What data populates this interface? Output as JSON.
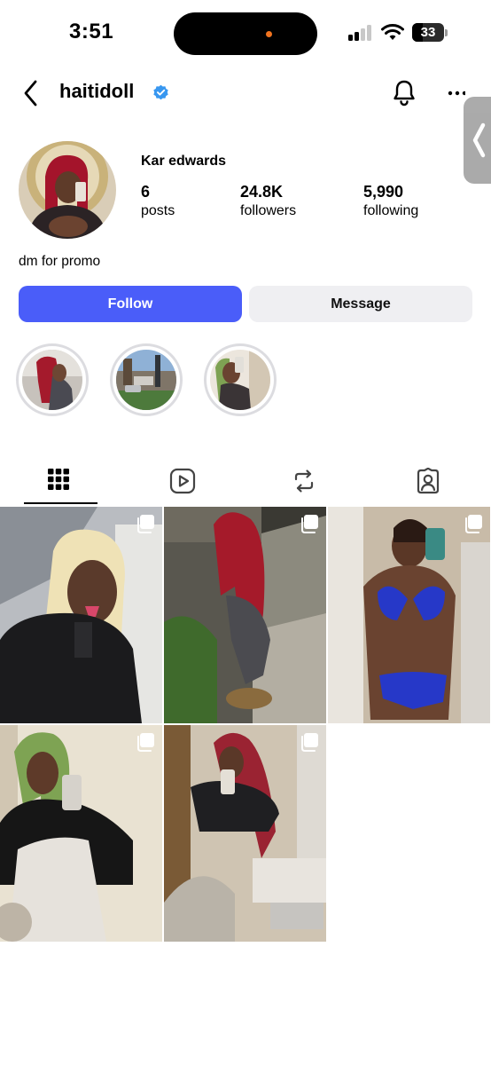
{
  "status_bar": {
    "time": "3:51",
    "battery": "33",
    "battery_level": 0.33,
    "recording_dot_color": "#f0731f"
  },
  "header": {
    "username": "haitidoll",
    "verified": true
  },
  "profile": {
    "display_name": "Kar edwards",
    "stats": [
      {
        "value": "6",
        "label": "posts"
      },
      {
        "value": "24.8K",
        "label": "followers"
      },
      {
        "value": "5,990",
        "label": "following"
      }
    ],
    "bio": "dm for promo"
  },
  "actions": {
    "follow_label": "Follow",
    "message_label": "Message"
  },
  "highlights": [
    {
      "icon": "highlight-photo"
    },
    {
      "icon": "highlight-photo"
    },
    {
      "icon": "highlight-photo"
    }
  ],
  "tabs": [
    {
      "icon": "grid-icon",
      "selected": true
    },
    {
      "icon": "reels-icon",
      "selected": false
    },
    {
      "icon": "reposts-icon",
      "selected": false
    },
    {
      "icon": "tagged-icon",
      "selected": false
    }
  ],
  "posts": [
    {
      "type": "multi",
      "icon": "carousel-icon"
    },
    {
      "type": "multi",
      "icon": "carousel-icon"
    },
    {
      "type": "multi",
      "icon": "carousel-icon"
    },
    {
      "type": "multi",
      "icon": "carousel-icon"
    },
    {
      "type": "multi",
      "icon": "carousel-icon"
    }
  ],
  "colors": {
    "follow_button": "#4a5df9",
    "message_button": "#efeff2",
    "verified_badge": "#3897f0"
  }
}
